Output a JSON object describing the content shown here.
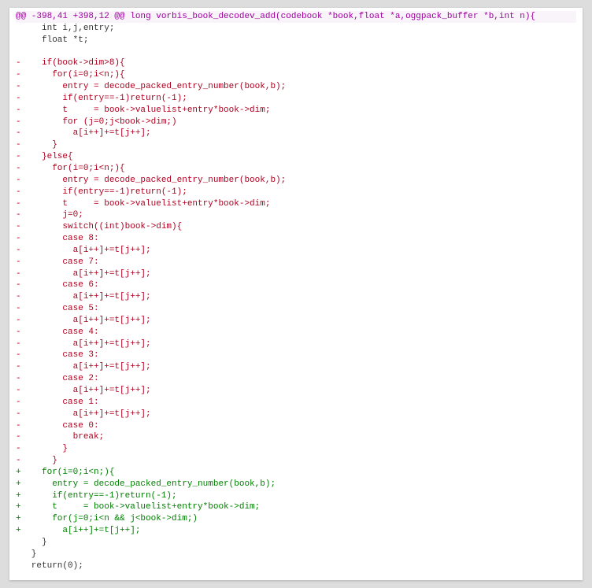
{
  "diff": {
    "hunk_header": "@@ -398,41 +398,12 @@ long vorbis_book_decodev_add(codebook *book,float *a,oggpack_buffer *b,int n){",
    "lines": [
      {
        "t": "ctx",
        "s": "     int i,j,entry;"
      },
      {
        "t": "ctx",
        "s": "     float *t;"
      },
      {
        "t": "ctx",
        "s": " "
      },
      {
        "t": "del",
        "s": "-    if(book->dim>8){"
      },
      {
        "t": "del",
        "s": "-      for(i=0;i<n;){"
      },
      {
        "t": "del",
        "s": "-        entry = decode_packed_entry_number(book,b);"
      },
      {
        "t": "del",
        "s": "-        if(entry==-1)return(-1);"
      },
      {
        "t": "del",
        "s": "-        t     = book->valuelist+entry*book->dim;"
      },
      {
        "t": "del",
        "s": "-        for (j=0;j<book->dim;)"
      },
      {
        "t": "del",
        "s": "-          a[i++]+=t[j++];"
      },
      {
        "t": "del",
        "s": "-      }"
      },
      {
        "t": "del",
        "s": "-    }else{"
      },
      {
        "t": "del",
        "s": "-      for(i=0;i<n;){"
      },
      {
        "t": "del",
        "s": "-        entry = decode_packed_entry_number(book,b);"
      },
      {
        "t": "del",
        "s": "-        if(entry==-1)return(-1);"
      },
      {
        "t": "del",
        "s": "-        t     = book->valuelist+entry*book->dim;"
      },
      {
        "t": "del",
        "s": "-        j=0;"
      },
      {
        "t": "del",
        "s": "-        switch((int)book->dim){"
      },
      {
        "t": "del",
        "s": "-        case 8:"
      },
      {
        "t": "del",
        "s": "-          a[i++]+=t[j++];"
      },
      {
        "t": "del",
        "s": "-        case 7:"
      },
      {
        "t": "del",
        "s": "-          a[i++]+=t[j++];"
      },
      {
        "t": "del",
        "s": "-        case 6:"
      },
      {
        "t": "del",
        "s": "-          a[i++]+=t[j++];"
      },
      {
        "t": "del",
        "s": "-        case 5:"
      },
      {
        "t": "del",
        "s": "-          a[i++]+=t[j++];"
      },
      {
        "t": "del",
        "s": "-        case 4:"
      },
      {
        "t": "del",
        "s": "-          a[i++]+=t[j++];"
      },
      {
        "t": "del",
        "s": "-        case 3:"
      },
      {
        "t": "del",
        "s": "-          a[i++]+=t[j++];"
      },
      {
        "t": "del",
        "s": "-        case 2:"
      },
      {
        "t": "del",
        "s": "-          a[i++]+=t[j++];"
      },
      {
        "t": "del",
        "s": "-        case 1:"
      },
      {
        "t": "del",
        "s": "-          a[i++]+=t[j++];"
      },
      {
        "t": "del",
        "s": "-        case 0:"
      },
      {
        "t": "del",
        "s": "-          break;"
      },
      {
        "t": "del",
        "s": "-        }"
      },
      {
        "t": "del",
        "s": "-      }"
      },
      {
        "t": "add",
        "s": "+    for(i=0;i<n;){"
      },
      {
        "t": "add",
        "s": "+      entry = decode_packed_entry_number(book,b);"
      },
      {
        "t": "add",
        "s": "+      if(entry==-1)return(-1);"
      },
      {
        "t": "add",
        "s": "+      t     = book->valuelist+entry*book->dim;"
      },
      {
        "t": "add",
        "s": "+      for(j=0;i<n && j<book->dim;)"
      },
      {
        "t": "add",
        "s": "+        a[i++]+=t[j++];"
      },
      {
        "t": "ctx",
        "s": "     }"
      },
      {
        "t": "ctx",
        "s": "   }"
      },
      {
        "t": "ctx",
        "s": "   return(0);"
      }
    ]
  }
}
